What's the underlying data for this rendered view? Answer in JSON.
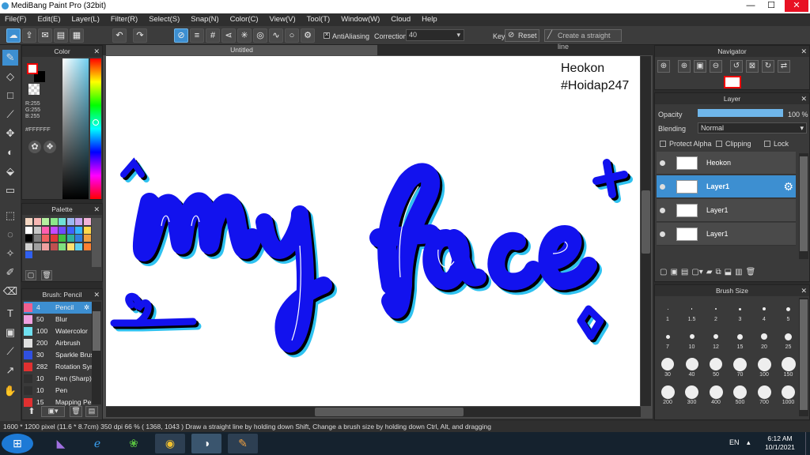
{
  "window": {
    "title": "MediBang Paint Pro (32bit)",
    "min": "—",
    "max": "☐",
    "close": "✕"
  },
  "menu": [
    "File(F)",
    "Edit(E)",
    "Layer(L)",
    "Filter(R)",
    "Select(S)",
    "Snap(N)",
    "Color(C)",
    "View(V)",
    "Tool(T)",
    "Window(W)",
    "Cloud",
    "Help"
  ],
  "toolbar": {
    "antialias_label": "AntiAliasing",
    "antialias_checked": true,
    "correction_label": "Correction",
    "correction_value": "40",
    "key_label": "Key",
    "reset_label": "Reset",
    "straight_label": "Create a straight line"
  },
  "color_panel": {
    "title": "Color",
    "r": "R:255",
    "g": "G:255",
    "b": "B:255",
    "hex": "#FFFFFF",
    "fg": "#ffffff",
    "bg": "#000000"
  },
  "palette_panel": {
    "title": "Palette",
    "colors": [
      "#f3d6c2",
      "#f7b7b3",
      "#b5f0a0",
      "#8be98a",
      "#6fe0d7",
      "#9db8f2",
      "#c7a4ef",
      "#f3b3d8",
      "#ffffff",
      "#c8c8c8",
      "#ff5eb0",
      "#c44bff",
      "#6f4bff",
      "#3e62ff",
      "#34b6ff",
      "#ffd94a",
      "#000000",
      "#808080",
      "#f06060",
      "#e03838",
      "#40c040",
      "#2eb0a0",
      "#3080e0",
      "#f0a040",
      "#d0d0d0",
      "#a0a0a0",
      "#f0a0a0",
      "#c05050",
      "#80e080",
      "#ffe070",
      "#60d0f0",
      "#ff8030",
      "#3060f0"
    ]
  },
  "brush_panel": {
    "title": "Brush: Pencil",
    "items": [
      {
        "size": "4",
        "name": "Pencil",
        "color": "#f06090",
        "selected": true
      },
      {
        "size": "50",
        "name": "Blur",
        "color": "#f0a0e0"
      },
      {
        "size": "100",
        "name": "Watercolor",
        "color": "#70e0f0"
      },
      {
        "size": "200",
        "name": "Airbrush",
        "color": "#e0e0e0"
      },
      {
        "size": "30",
        "name": "Sparkle Brush",
        "color": "#3050e0"
      },
      {
        "size": "282",
        "name": "Rotation Sym",
        "color": "#e03030"
      },
      {
        "size": "10",
        "name": "Pen (Sharp)",
        "color": "#303030"
      },
      {
        "size": "10",
        "name": "Pen",
        "color": "#303030"
      },
      {
        "size": "15",
        "name": "Mapping Pen",
        "color": "#e03030"
      }
    ]
  },
  "canvas": {
    "tab": "Untitled",
    "text1": "Heokon",
    "text2": "#Hoidap247"
  },
  "navigator": {
    "title": "Navigator"
  },
  "layer_panel": {
    "title": "Layer",
    "opacity_label": "Opacity",
    "opacity_value": "100 %",
    "opacity_fraction": 1.0,
    "blending_label": "Blending",
    "blending_value": "Normal",
    "protect_alpha": "Protect Alpha",
    "clipping": "Clipping",
    "lock": "Lock",
    "layers": [
      {
        "name": "Heokon",
        "selected": false
      },
      {
        "name": "Layer1",
        "selected": true
      },
      {
        "name": "Layer1",
        "selected": false
      },
      {
        "name": "Layer1",
        "selected": false
      }
    ]
  },
  "brush_size_panel": {
    "title": "Brush Size",
    "sizes": [
      "1",
      "1.5",
      "2",
      "3",
      "4",
      "5",
      "7",
      "10",
      "12",
      "15",
      "20",
      "25",
      "30",
      "40",
      "50",
      "70",
      "100",
      "150",
      "200",
      "300",
      "400",
      "500",
      "700",
      "1000"
    ]
  },
  "status": {
    "text": "1600 * 1200 pixel   (11.6 * 8.7cm)   350 dpi   66 %   ( 1368, 1043 )   Draw a straight line by holding down Shift, Change a brush size by holding down Ctrl, Alt, and dragging"
  },
  "taskbar": {
    "lang": "EN",
    "time": "6:12 AM",
    "date": "10/1/2021"
  },
  "colors": {
    "accent": "#3d8fd1",
    "ink_blue": "#1212ee",
    "ink_cyan": "#2fc2f0"
  }
}
